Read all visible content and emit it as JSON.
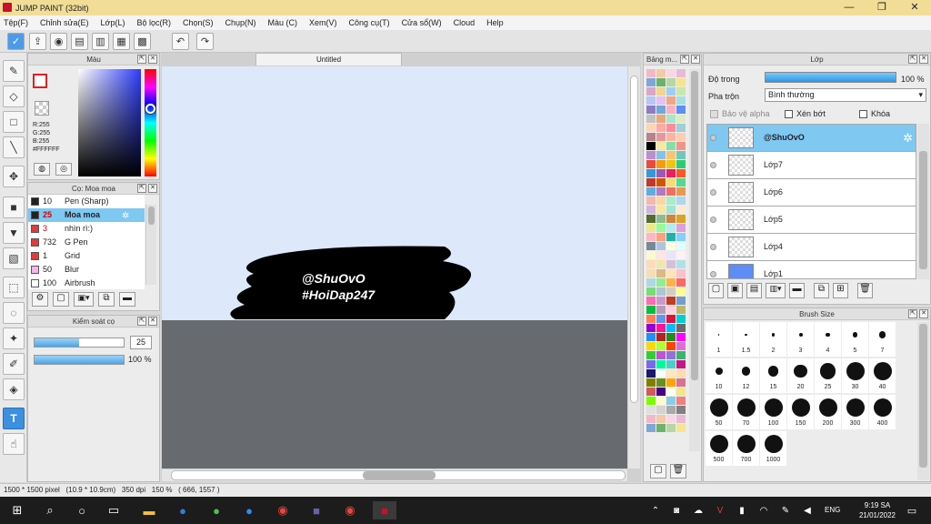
{
  "window": {
    "title": "JUMP PAINT (32bit)",
    "minimize": "—",
    "maximize": "❐",
    "close": "✕"
  },
  "menu": [
    "Tệp(F)",
    "Chỉnh sửa(E)",
    "Lớp(L)",
    "Bộ lọc(R)",
    "Chọn(S)",
    "Chụp(N)",
    "Màu (C)",
    "Xem(V)",
    "Công cụ(T)",
    "Cửa sổ(W)",
    "Cloud",
    "Help"
  ],
  "color_panel": {
    "title": "Màu",
    "r": "R:255",
    "g": "G:255",
    "b": "B:255",
    "hex": "#FFFFFF"
  },
  "brush_panel": {
    "title": "Cọ: Moa moa",
    "items": [
      {
        "size": "10",
        "name": "Pen (Sharp)",
        "color": "#222222"
      },
      {
        "size": "25",
        "name": "Moa moa",
        "color": "#222222"
      },
      {
        "size": "3",
        "name": "nhìn rì:)",
        "color": "#e03a3a"
      },
      {
        "size": "732",
        "name": "G Pen",
        "color": "#e03a3a"
      },
      {
        "size": "1",
        "name": "Grid",
        "color": "#e03a3a"
      },
      {
        "size": "50",
        "name": "Blur",
        "color": "#f4b6e8"
      },
      {
        "size": "100",
        "name": "Airbrush",
        "color": "#ffffff"
      }
    ]
  },
  "brush_control": {
    "title": "Kiểm soát cọ",
    "size_value": "25",
    "opacity_value": "100 %",
    "size_level": 0.5,
    "opacity_level": 1.0
  },
  "canvas": {
    "tab": "Untitled",
    "line1": "@ShuOvO",
    "line2": "#HoiDap247"
  },
  "status": {
    "size": "1500 * 1500 pixel",
    "cm": "(10.9 * 10.9cm)",
    "dpi": "350 dpi",
    "zoom": "150 %",
    "coords": "( 666, 1557 )"
  },
  "palette_panel": {
    "title": "Bảng m..."
  },
  "layer_panel": {
    "title": "Lớp",
    "opacity_label": "Độ trong",
    "opacity_value": "100 %",
    "blend_label": "Pha trộn",
    "blend_value": "Bình thường",
    "protect_alpha": "Bảo vệ alpha",
    "clip": "Xén bớt",
    "lock": "Khóa",
    "layers": [
      {
        "name": "@ShuOvO",
        "selected": true
      },
      {
        "name": "Lớp7"
      },
      {
        "name": "Lớp6"
      },
      {
        "name": "Lớp5"
      },
      {
        "name": "Lớp4"
      },
      {
        "name": "Lớp1"
      }
    ]
  },
  "brush_size": {
    "title": "Brush Size",
    "sizes": [
      "1",
      "1.5",
      "2",
      "3",
      "4",
      "5",
      "7",
      "10",
      "12",
      "15",
      "20",
      "25",
      "30",
      "40",
      "50",
      "70",
      "100",
      "150",
      "200",
      "300",
      "400",
      "500",
      "700",
      "1000"
    ]
  },
  "taskbar": {
    "lang": "ENG",
    "time": "9:19 SA",
    "date": "21/01/2022"
  },
  "colors": {
    "accent": "#3d8fe0",
    "selected_layer": "#7ec8f2",
    "titlebar": "#f1dd96",
    "canvas_bg": "#dde8fb",
    "canvas_gray": "#676a6f"
  }
}
